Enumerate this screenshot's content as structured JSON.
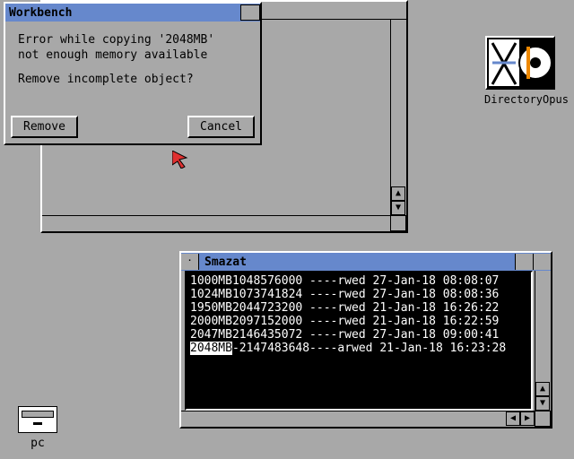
{
  "dialog": {
    "title": "Workbench",
    "line1": "Error while copying '2048MB'",
    "line2": "not enough memory available",
    "line3": "Remove incomplete object?",
    "remove_label": "Remove",
    "cancel_label": "Cancel"
  },
  "desktop": {
    "diropus_label": "DirectoryOpus",
    "pc_label": "pc"
  },
  "smazat": {
    "title": "Smazat",
    "rows": [
      {
        "name": "1000MB",
        "size": "1048576000",
        "flags": "----rwed",
        "date": "27-Jan-18",
        "time": "08:08:07",
        "selected": false
      },
      {
        "name": "1024MB",
        "size": "1073741824",
        "flags": "----rwed",
        "date": "27-Jan-18",
        "time": "08:08:36",
        "selected": false
      },
      {
        "name": "1950MB",
        "size": "2044723200",
        "flags": "----rwed",
        "date": "21-Jan-18",
        "time": "16:26:22",
        "selected": false
      },
      {
        "name": "2000MB",
        "size": "2097152000",
        "flags": "----rwed",
        "date": "21-Jan-18",
        "time": "16:22:59",
        "selected": false
      },
      {
        "name": "2047MB",
        "size": "2146435072",
        "flags": "----rwed",
        "date": "27-Jan-18",
        "time": "09:00:41",
        "selected": false
      },
      {
        "name": "2048MB",
        "size": "-2147483648",
        "flags": "----arwed",
        "date": "21-Jan-18",
        "time": "16:23:28",
        "selected": true
      }
    ]
  }
}
